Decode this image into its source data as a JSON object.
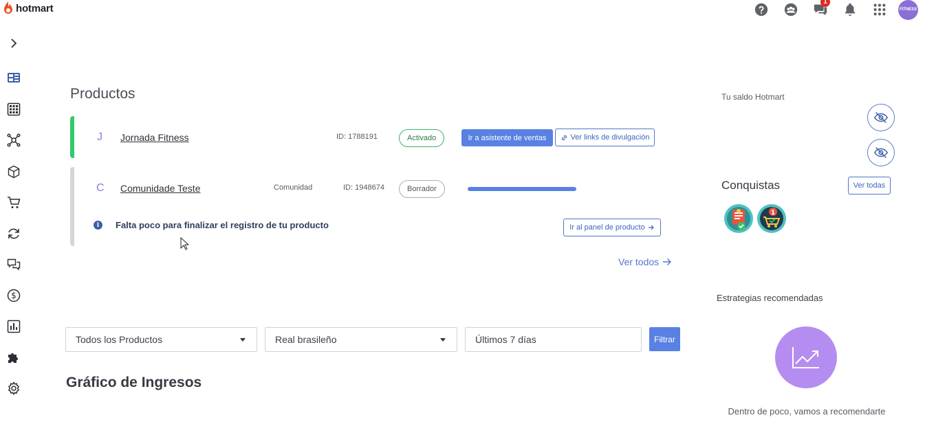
{
  "app": {
    "logo_text": "hotmart"
  },
  "topbar": {
    "notifications_count": "1",
    "avatar_text": "FITNESS"
  },
  "sidebar": {
    "items": [
      {
        "icon": "chevron-right-icon"
      },
      {
        "icon": "dashboard-icon"
      },
      {
        "icon": "apps-grid-icon"
      },
      {
        "icon": "network-icon"
      },
      {
        "icon": "box-icon"
      },
      {
        "icon": "cart-icon"
      },
      {
        "icon": "sync-icon"
      },
      {
        "icon": "chat-icon"
      },
      {
        "icon": "dollar-icon"
      },
      {
        "icon": "bar-chart-icon"
      },
      {
        "icon": "puzzle-icon"
      },
      {
        "icon": "gear-icon"
      }
    ]
  },
  "products": {
    "title": "Productos",
    "items": [
      {
        "initial": "J",
        "name": "Jornada Fitness",
        "id_label": "ID: 1788191",
        "status": "Activado",
        "primary_action": "Ir a asistente de ventas",
        "secondary_action": "Ver links de divulgación"
      },
      {
        "initial": "C",
        "name": "Comunidade Teste",
        "type": "Comunidad",
        "id_label": "ID: 1948674",
        "status": "Borrador",
        "notice": "Falta poco para finalizar el registro de tu producto",
        "notice_action": "Ir al panel de producto"
      }
    ],
    "see_all": "Ver todos"
  },
  "filters": {
    "product_select": "Todos los Productos",
    "currency_select": "Real brasileño",
    "period_select": "Últimos 7 días",
    "filter_button": "Filtrar"
  },
  "revenue_chart": {
    "title": "Gráfico de Ingresos"
  },
  "right_panel": {
    "balance_label": "Tu saldo Hotmart",
    "achievements_title": "Conquistas",
    "achievements_button": "Ver todas",
    "strategies_title": "Estrategias recomendadas",
    "strategies_text": "Dentro de poco, vamos a recomendarte"
  },
  "colors": {
    "accent": "#5981e3",
    "active_green": "#35c86e",
    "draft_grey": "#d4d6da",
    "strategy_purple": "#b58df0"
  }
}
